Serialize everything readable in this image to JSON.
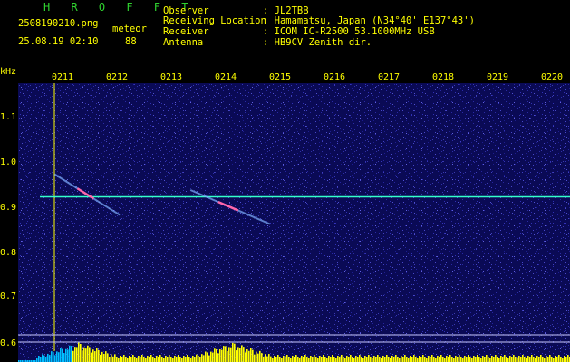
{
  "header": {
    "brand": "H R O F F T",
    "filename": "2508190210.png",
    "event_label": "meteor",
    "datetime": "25.08.19 02:10",
    "event_count": "88",
    "fields": [
      {
        "label": "Observer",
        "value": ": JL2TBB"
      },
      {
        "label": "Receiving Location",
        "value": ": Hamamatsu, Japan (N34°40' E137°43')"
      },
      {
        "label": "Receiver",
        "value": ": ICOM IC-R2500 53.1000MHz USB"
      },
      {
        "label": "Antenna",
        "value": ": HB9CV Zenith dir."
      }
    ]
  },
  "axis": {
    "unit": "kHz",
    "time_ticks": [
      "0211",
      "0212",
      "0213",
      "0214",
      "0215",
      "0216",
      "0217",
      "0218",
      "0219",
      "0220"
    ],
    "freq_ticks": [
      "1.1",
      "1.0",
      "0.9",
      "0.8",
      "0.7",
      "0.6"
    ]
  },
  "colors": {
    "background": "#000000",
    "plot_background": "#0a0a55",
    "text_yellow": "#ffff00",
    "text_white": "#e8e8e8",
    "brand_green": "#2fd12f",
    "carrier_line": "#33ffcc",
    "meteor_trail": "#ff66aa",
    "bar_yellow": "#ffff00",
    "baseline_cyan": "#00bfff"
  },
  "carrier": {
    "freq_khz": 0.925,
    "time_start": "0210.9",
    "time_end": "0220"
  },
  "meteors": [
    {
      "t_start_min": 1.22,
      "f_start_khz": 0.975,
      "t_end_min": 2.42,
      "f_end_khz": 0.885
    },
    {
      "t_start_min": 3.72,
      "f_start_khz": 0.94,
      "t_end_min": 5.18,
      "f_end_khz": 0.865
    }
  ],
  "activity_bursts": [
    {
      "center_min": 1.65,
      "strength": 1.0
    },
    {
      "center_min": 4.5,
      "strength": 1.0
    }
  ]
}
